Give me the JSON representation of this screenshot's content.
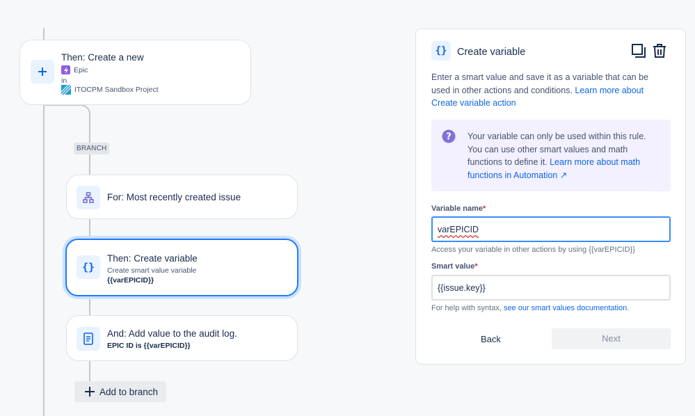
{
  "flow": {
    "trigger_card": {
      "title": "Then: Create a new",
      "issue_type": "Epic",
      "in_label": "in",
      "project": "ITOCPM Sandbox Project"
    },
    "branch_tag": "BRANCH",
    "for_card": {
      "title": "For: Most recently created issue"
    },
    "variable_card": {
      "title": "Then: Create variable",
      "subtitle": "Create smart value variable",
      "value": "{{varEPICID}}"
    },
    "audit_card": {
      "title": "And: Add value to the audit log.",
      "value": "EPIC ID is {{varEPICID}}"
    },
    "add_to_branch": "Add to branch"
  },
  "panel": {
    "title": "Create variable",
    "description": "Enter a smart value and save it as a variable that can be used in other actions and conditions.",
    "description_link": "Learn more about Create variable action",
    "info_text": "Your variable can only be used within this rule. You can use other smart values and math functions to define it.",
    "info_link": "Learn more about math functions in Automation ↗",
    "variable_name_label": "Variable name",
    "variable_name_value": "varEPICID",
    "variable_name_help": "Access your variable in other actions by using {{varEPICID}}",
    "smart_value_label": "Smart value",
    "smart_value_value": "{{issue.key}}",
    "smart_value_help": "For help with syntax,",
    "smart_value_help_link": "see our smart values documentation.",
    "required_mark": "*",
    "back_label": "Back",
    "next_label": "Next"
  },
  "colors": {
    "accent": "#0c66e4",
    "selected_border": "#1d7afc",
    "info_bg": "#f3f0ff",
    "info_icon": "#8270db",
    "epic_purple": "#8f5de6"
  }
}
